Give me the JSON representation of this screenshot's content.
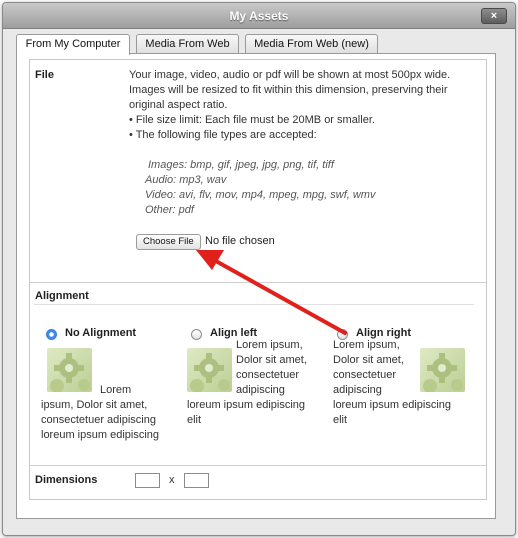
{
  "window": {
    "title": "My Assets",
    "close_label": "×"
  },
  "tabs": [
    {
      "label": "From My Computer",
      "active": true
    },
    {
      "label": "Media From Web",
      "active": false
    },
    {
      "label": "Media From Web (new)",
      "active": false
    }
  ],
  "file_section": {
    "label": "File",
    "info_lines": [
      "Your image, video, audio or pdf will be shown at most 500px wide.",
      "Images will be resized to fit within this dimension, preserving their",
      "original aspect ratio.",
      "• File size limit: Each file must be 20MB or smaller.",
      "• The following file types are accepted:"
    ],
    "types": [
      "Images: bmp, gif, jpeg, jpg, png, tif, tiff",
      "Audio: mp3, wav",
      "Video: avi, flv, mov, mp4, mpeg, mpg, swf, wmv",
      "Other: pdf"
    ],
    "choose_button": "Choose File",
    "no_file_text": "No file chosen"
  },
  "alignment_section": {
    "label": "Alignment",
    "options": [
      {
        "label": "No Alignment",
        "checked": true,
        "lines": [
          "Lorem",
          "ipsum, Dolor sit amet,",
          "consectetuer adipiscing",
          "loreum ipsum edipiscing"
        ]
      },
      {
        "label": "Align left",
        "checked": false,
        "lines": [
          "Lorem ipsum,",
          "Dolor sit amet,",
          "consectetuer",
          "adipiscing",
          "loreum ipsum edipiscing",
          "elit"
        ]
      },
      {
        "label": "Align right",
        "checked": false,
        "lines": [
          "Lorem ipsum,",
          "Dolor sit amet,",
          "consectetuer",
          "adipiscing",
          "loreum ipsum edipiscing",
          "elit"
        ]
      }
    ]
  },
  "dimensions_section": {
    "label": "Dimensions",
    "width_value": "",
    "height_value": "",
    "separator": "x"
  },
  "colors": {
    "arrow": "#e0201b",
    "radio_selected": "#3d8cf0"
  }
}
